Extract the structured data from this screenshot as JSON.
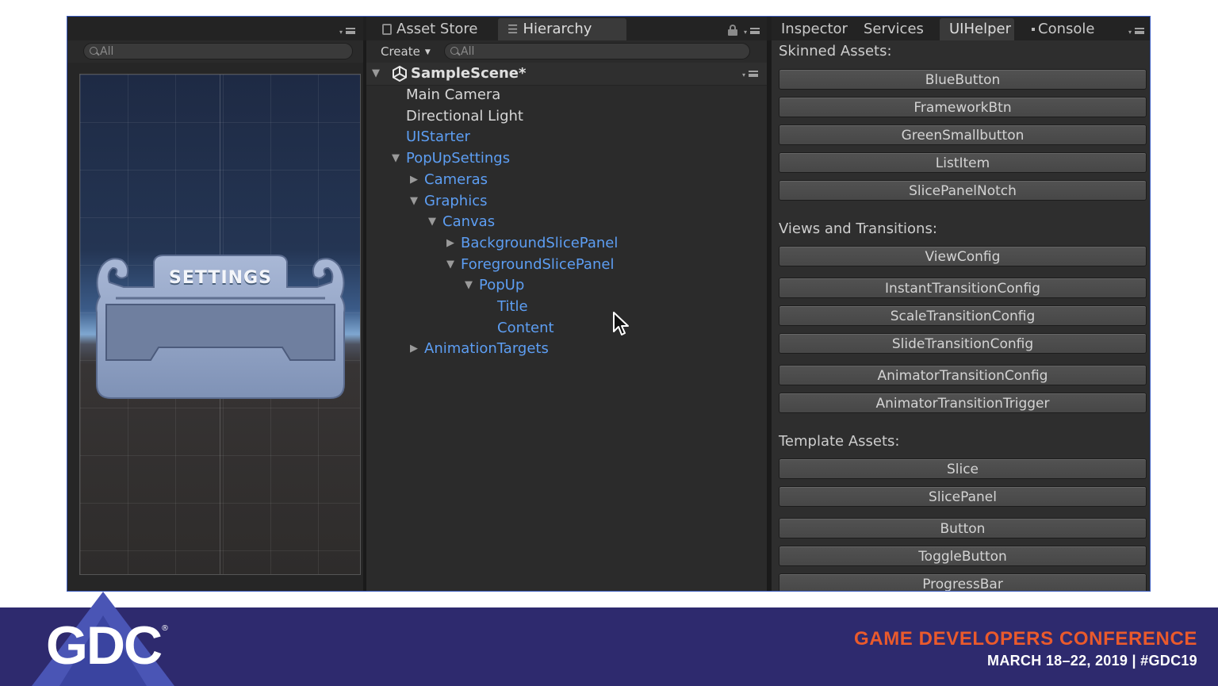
{
  "game_panel": {
    "search_placeholder": "All",
    "popup_title": "SETTINGS"
  },
  "hierarchy_panel": {
    "tabs": [
      {
        "label": "Asset Store",
        "icon": "asset-store-icon"
      },
      {
        "label": "Hierarchy",
        "icon": "hierarchy-list-icon",
        "active": true
      }
    ],
    "create_label": "Create",
    "search_placeholder": "All",
    "scene_name": "SampleScene*",
    "items": [
      {
        "label": "Main Camera",
        "depth": 0,
        "expand": "none",
        "color": "white"
      },
      {
        "label": "Directional Light",
        "depth": 0,
        "expand": "none",
        "color": "white"
      },
      {
        "label": "UIStarter",
        "depth": 0,
        "expand": "none",
        "color": "blue"
      },
      {
        "label": "PopUpSettings",
        "depth": 0,
        "expand": "expanded",
        "color": "blue"
      },
      {
        "label": "Cameras",
        "depth": 1,
        "expand": "collapsed",
        "color": "blue"
      },
      {
        "label": "Graphics",
        "depth": 1,
        "expand": "expanded",
        "color": "blue"
      },
      {
        "label": "Canvas",
        "depth": 2,
        "expand": "expanded",
        "color": "blue"
      },
      {
        "label": "BackgroundSlicePanel",
        "depth": 3,
        "expand": "collapsed",
        "color": "blue"
      },
      {
        "label": "ForegroundSlicePanel",
        "depth": 3,
        "expand": "expanded",
        "color": "blue"
      },
      {
        "label": "PopUp",
        "depth": 4,
        "expand": "expanded",
        "color": "blue"
      },
      {
        "label": "Title",
        "depth": 5,
        "expand": "none",
        "color": "blue"
      },
      {
        "label": "Content",
        "depth": 5,
        "expand": "none",
        "color": "blue"
      },
      {
        "label": "AnimationTargets",
        "depth": 1,
        "expand": "collapsed",
        "color": "blue"
      }
    ]
  },
  "inspector_panel": {
    "tabs": [
      {
        "label": "Inspector"
      },
      {
        "label": "Services"
      },
      {
        "label": "UIHelper",
        "active": true
      },
      {
        "label": "Console"
      }
    ],
    "sections": [
      {
        "title": "Skinned Assets:",
        "buttons": [
          "BlueButton",
          "FrameworkBtn",
          "GreenSmallbutton",
          "ListItem",
          "SlicePanelNotch"
        ]
      },
      {
        "title": "Views and Transitions:",
        "buttons": [
          "ViewConfig",
          "InstantTransitionConfig",
          "ScaleTransitionConfig",
          "SlideTransitionConfig",
          "AnimatorTransitionConfig",
          "AnimatorTransitionTrigger"
        ]
      },
      {
        "title": "Template Assets:",
        "buttons": [
          "Slice",
          "SlicePanel",
          "Button",
          "ToggleButton",
          "ProgressBar"
        ]
      }
    ]
  },
  "footer": {
    "logo_text": "GDC",
    "registered_mark": "®",
    "conference_name": "GAME DEVELOPERS CONFERENCE",
    "dates": "MARCH 18–22, 2019  |  #GDC19"
  },
  "colors": {
    "footer_bg": "#2e2a6e",
    "conference_orange": "#ea5a2c",
    "hierarchy_blue": "#5d9ef3",
    "editor_border": "#3a5bbf"
  }
}
